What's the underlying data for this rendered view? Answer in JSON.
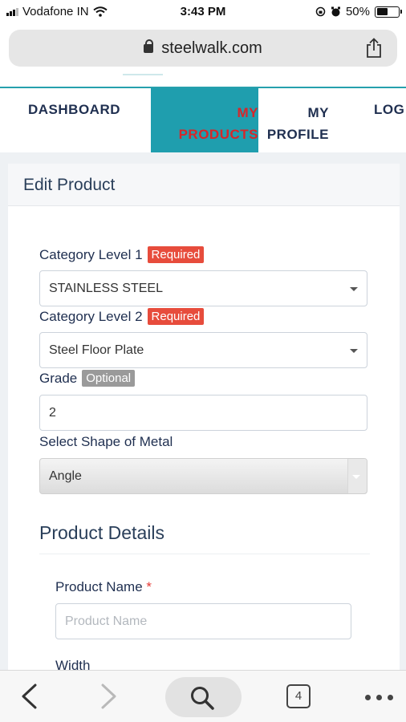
{
  "status_bar": {
    "carrier": "Vodafone IN",
    "time": "3:43 PM",
    "battery": "50%",
    "battery_level": 0.5
  },
  "browser": {
    "url": "steelwalk.com",
    "open_tabs": "4"
  },
  "nav": {
    "dashboard": "DASHBOARD",
    "products_line1": "MY",
    "products_line2": "PRODUCTS",
    "profile_line1": "MY",
    "profile_line2": "PROFILE",
    "logout": "LOG"
  },
  "card": {
    "title": "Edit Product"
  },
  "form": {
    "cat1_label": "Category Level 1",
    "cat1_badge": "Required",
    "cat1_value": "STAINLESS STEEL",
    "cat2_label": "Category Level 2",
    "cat2_badge": "Required",
    "cat2_value": "Steel Floor Plate",
    "grade_label": "Grade",
    "grade_badge": "Optional",
    "grade_value": "2",
    "shape_label": "Select Shape of Metal",
    "shape_value": "Angle"
  },
  "details": {
    "title": "Product Details",
    "product_name_label": "Product Name",
    "required_mark": "*",
    "product_name_placeholder": "Product Name",
    "width_label": "Width"
  },
  "colors": {
    "accent_teal": "#1f9eae",
    "active_text_red": "#d7262a",
    "required_badge": "#e74c3c",
    "optional_badge": "#9a9a9a",
    "navy_text": "#1f2f50"
  }
}
